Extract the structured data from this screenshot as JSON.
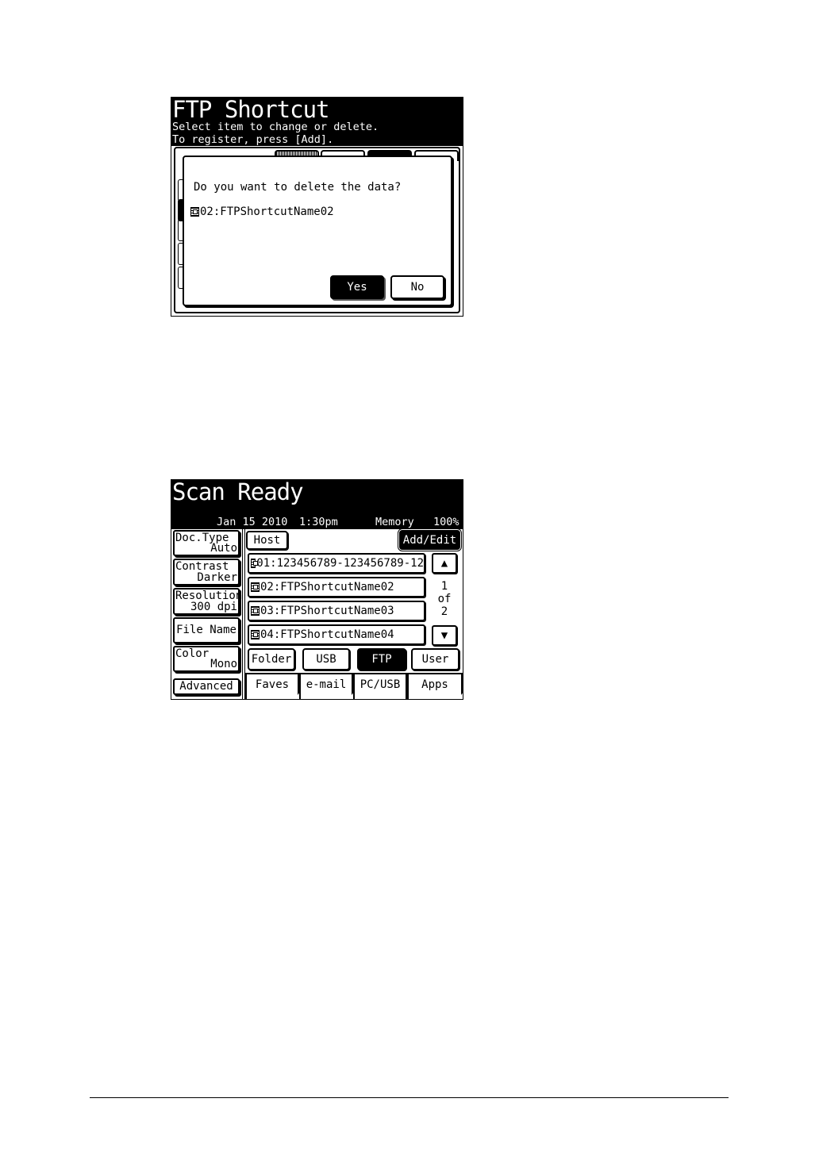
{
  "ftp_panel": {
    "title": "FTP Shortcut",
    "subtitle_line1": "Select item to change or delete.",
    "subtitle_line2": "To register, press [Add].",
    "dialog": {
      "message": "Do you want to delete the data?",
      "item": "02:FTPShortcutName02",
      "yes_label": "Yes",
      "no_label": "No"
    }
  },
  "scan_panel": {
    "title": "Scan Ready",
    "status": {
      "date": "Jan 15 2010",
      "time": "1:30pm",
      "memory_label": "Memory",
      "memory_value": "100%"
    },
    "left_buttons": [
      {
        "line1": "Doc.Type",
        "line2": "Auto"
      },
      {
        "line1": "Contrast",
        "line2": "Darker"
      },
      {
        "line1": "Resolution",
        "line2": "300 dpi"
      },
      {
        "label": "File Name"
      },
      {
        "line1": "Color",
        "line2": "Mono"
      }
    ],
    "advanced_label": "Advanced",
    "host_label": "Host",
    "add_edit_label": "Add/Edit",
    "list_items": [
      "01:123456789-123456789-12",
      "02:FTPShortcutName02",
      "03:FTPShortcutName03",
      "04:FTPShortcutName04"
    ],
    "pager": {
      "current": "1",
      "of": "of",
      "total": "2"
    },
    "destinations": [
      "Folder",
      "USB",
      "FTP",
      "User"
    ],
    "selected_destination": "FTP",
    "tabs": [
      "Faves",
      "e-mail",
      "PC/USB",
      "Apps"
    ],
    "active_tab": "PC/USB"
  }
}
